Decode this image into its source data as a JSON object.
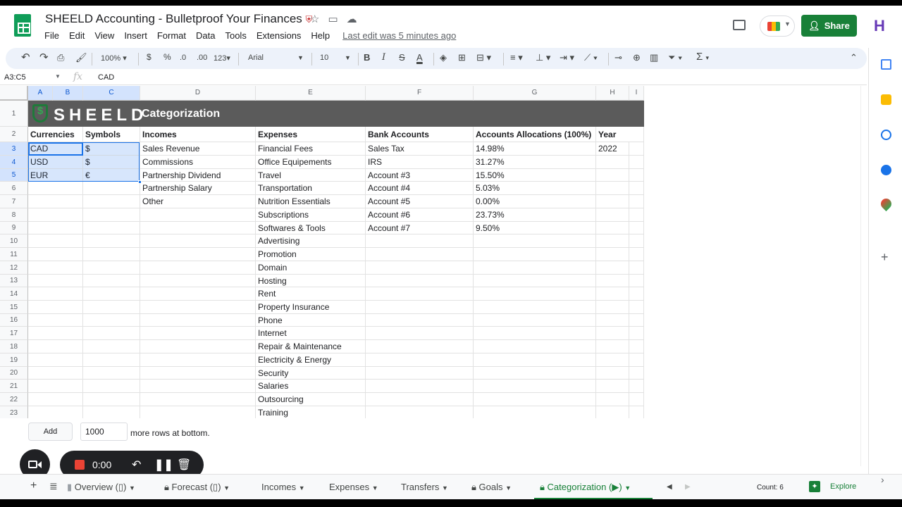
{
  "app": {
    "doc_title": "SHEELD Accounting - Bulletproof Your Finances",
    "last_edit": "Last edit was 5 minutes ago",
    "share_label": "Share",
    "avatar_letter": "H"
  },
  "menu": [
    "File",
    "Edit",
    "View",
    "Insert",
    "Format",
    "Data",
    "Tools",
    "Extensions",
    "Help"
  ],
  "toolbar": {
    "zoom": "100%",
    "currency": "$",
    "percent": "%",
    "dec_less": ".0",
    "dec_more": ".00",
    "more_formats": "123",
    "font": "Arial",
    "font_size": "10",
    "bold": "B",
    "italic": "I",
    "strike": "S",
    "text_color": "A",
    "sum": "Σ"
  },
  "formula_bar": {
    "name_box": "A3:C5",
    "fx": "fx",
    "value": "CAD"
  },
  "columns": [
    "A",
    "B",
    "C",
    "D",
    "E",
    "F",
    "G",
    "H",
    "I"
  ],
  "rows": [
    "1",
    "2",
    "3",
    "4",
    "5",
    "6",
    "7",
    "8",
    "9",
    "10",
    "11",
    "12",
    "13",
    "14",
    "15",
    "16",
    "17",
    "18",
    "19",
    "20",
    "21",
    "22",
    "23"
  ],
  "banner": {
    "logo_text": "SHEELD",
    "title": "Categorization"
  },
  "headers": {
    "currencies": "Currencies",
    "symbols": "Symbols",
    "incomes": "Incomes",
    "expenses": "Expenses",
    "bank_accounts": "Bank Accounts",
    "allocations": "Accounts Allocations (100%)",
    "year": "Year"
  },
  "currencies": [
    {
      "code": "CAD",
      "symbol": "$"
    },
    {
      "code": "USD",
      "symbol": "$"
    },
    {
      "code": "EUR",
      "symbol": "€"
    }
  ],
  "incomes": [
    "Sales Revenue",
    "Commissions",
    "Partnership Dividend",
    "Partnership Salary",
    "Other"
  ],
  "expenses": [
    "Financial Fees",
    "Office Equipements",
    "Travel",
    "Transportation",
    "Nutrition Essentials",
    "Subscriptions",
    "Softwares & Tools",
    "Advertising",
    "Promotion",
    "Domain",
    "Hosting",
    "Rent",
    "Property Insurance",
    "Phone",
    "Internet",
    "Repair & Maintenance",
    "Electricity & Energy",
    "Security",
    "Salaries",
    "Outsourcing",
    "Training"
  ],
  "bank_accounts": [
    {
      "name": "Sales Tax",
      "allocation": "14.98%"
    },
    {
      "name": "IRS",
      "allocation": "31.27%"
    },
    {
      "name": "Account #3",
      "allocation": "15.50%"
    },
    {
      "name": "Account #4",
      "allocation": "5.03%"
    },
    {
      "name": "Account #5",
      "allocation": "0.00%"
    },
    {
      "name": "Account #6",
      "allocation": "23.73%"
    },
    {
      "name": "Account #7",
      "allocation": "9.50%"
    }
  ],
  "year": "2022",
  "add_rows": {
    "button": "Add",
    "count": "1000",
    "suffix": "more rows at bottom."
  },
  "recorder": {
    "time": "0:00"
  },
  "tabs": [
    {
      "label": "Overview (▯)",
      "locked": false,
      "has_doc_icon": true
    },
    {
      "label": "Forecast (▯)",
      "locked": true
    },
    {
      "label": "Incomes",
      "locked": false
    },
    {
      "label": "Expenses",
      "locked": false
    },
    {
      "label": "Transfers",
      "locked": false
    },
    {
      "label": "Goals",
      "locked": true
    },
    {
      "label": "Categorization (▶)",
      "locked": true,
      "active": true
    }
  ],
  "status": {
    "count": "Count: 6",
    "explore": "Explore"
  },
  "colors": {
    "brand_green": "#188038",
    "banner_gray": "#5b5b5b",
    "selection_blue": "#1a73e8"
  }
}
